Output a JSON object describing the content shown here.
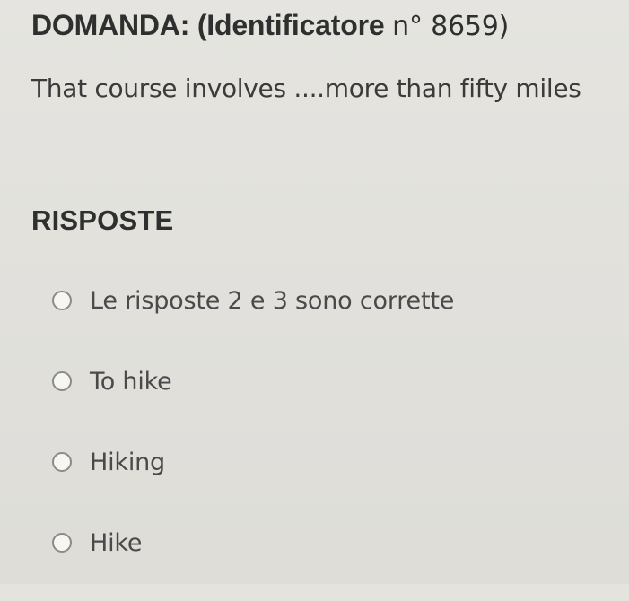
{
  "question": {
    "title_prefix": "DOMANDA: (Identificatore",
    "title_number": "n° 8659)",
    "text": "That course involves ....more than fifty miles"
  },
  "answers": {
    "heading": "RISPOSTE",
    "options": [
      {
        "label": "Le risposte 2 e 3 sono corrette",
        "icon": "radio-unselected-icon"
      },
      {
        "label": "To hike",
        "icon": "radio-unselected-icon"
      },
      {
        "label": "Hiking",
        "icon": "radio-unselected-icon"
      },
      {
        "label": "Hike",
        "icon": "radio-unselected-icon"
      }
    ]
  }
}
